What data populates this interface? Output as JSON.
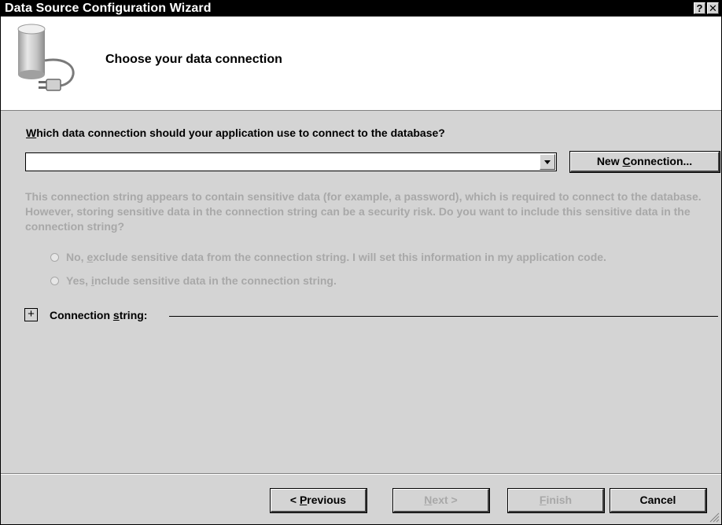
{
  "window": {
    "title": "Data Source Configuration Wizard",
    "help_label": "?",
    "close_label": "✕"
  },
  "header": {
    "title": "Choose your data connection",
    "icon": "database-connection-icon"
  },
  "question": {
    "prefix": "W",
    "rest": "hich data connection should your application use to connect to the database?"
  },
  "connection_combo": {
    "value": ""
  },
  "new_connection_button": {
    "prefix": "New ",
    "mnemonic": "C",
    "rest": "onnection..."
  },
  "sensitive_text": "This connection string appears to contain sensitive data (for example, a password), which is required to connect to the database. However, storing sensitive data in the connection string can be a security risk. Do you want to include this sensitive data in the connection string?",
  "radio_options": [
    {
      "prefix": "No, ",
      "mnemonic": "e",
      "rest": "xclude sensitive data from the connection string. I will set this information in my application code.",
      "enabled": false,
      "selected": false
    },
    {
      "prefix": "Yes, ",
      "mnemonic": "i",
      "rest": "nclude sensitive data in the connection string.",
      "enabled": false,
      "selected": false
    }
  ],
  "connection_string": {
    "expander": "+",
    "prefix": "Connection ",
    "mnemonic": "s",
    "rest": "tring:"
  },
  "footer_buttons": {
    "previous": {
      "prefix": "< ",
      "mnemonic": "P",
      "rest": "revious",
      "enabled": true
    },
    "next": {
      "mnemonic": "N",
      "rest": "ext >",
      "enabled": false
    },
    "finish": {
      "mnemonic": "F",
      "rest": "inish",
      "enabled": false
    },
    "cancel": {
      "label": "Cancel",
      "enabled": true
    }
  },
  "colors": {
    "dialog_bg": "#d4d4d4",
    "disabled_text": "#a8a8a8",
    "titlebar_bg": "#000000"
  }
}
